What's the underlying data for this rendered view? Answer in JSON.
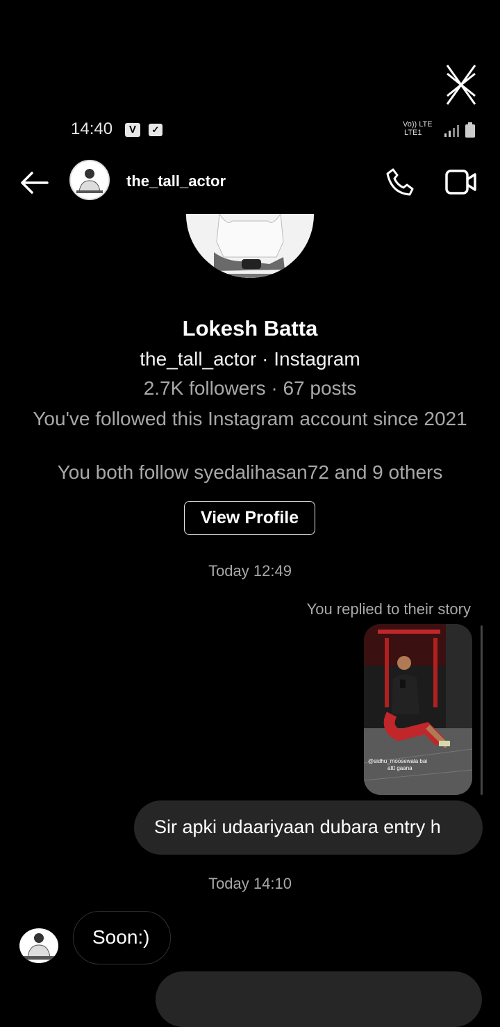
{
  "status_bar": {
    "time": "14:40",
    "network_label_top": "Vo)) LTE",
    "network_label_bottom": "LTE1"
  },
  "header": {
    "username": "the_tall_actor"
  },
  "profile": {
    "name": "Lokesh Batta",
    "handle_line": "the_tall_actor · Instagram",
    "stats": "2.7K followers · 67 posts",
    "since": "You've followed this Instagram account since 2021",
    "mutual": "You both follow syedalihasan72 and 9 others",
    "view_profile_label": "View Profile"
  },
  "messages": {
    "time_1": "Today 12:49",
    "reply_label": "You replied to their story",
    "story_caption": "@sidhu_moosewala bai attt gaana",
    "sent_text": "Sir apki udaariyaan dubara entry h",
    "time_2": "Today 14:10",
    "received_text": "Soon:)"
  },
  "icons": {
    "close": "close-icon",
    "back": "back-arrow-icon",
    "phone": "phone-icon",
    "video": "video-icon",
    "signal": "signal-icon",
    "battery": "battery-icon"
  },
  "colors": {
    "background": "#000000",
    "secondary_text": "#a8a8a8",
    "sent_bubble": "#262626"
  }
}
